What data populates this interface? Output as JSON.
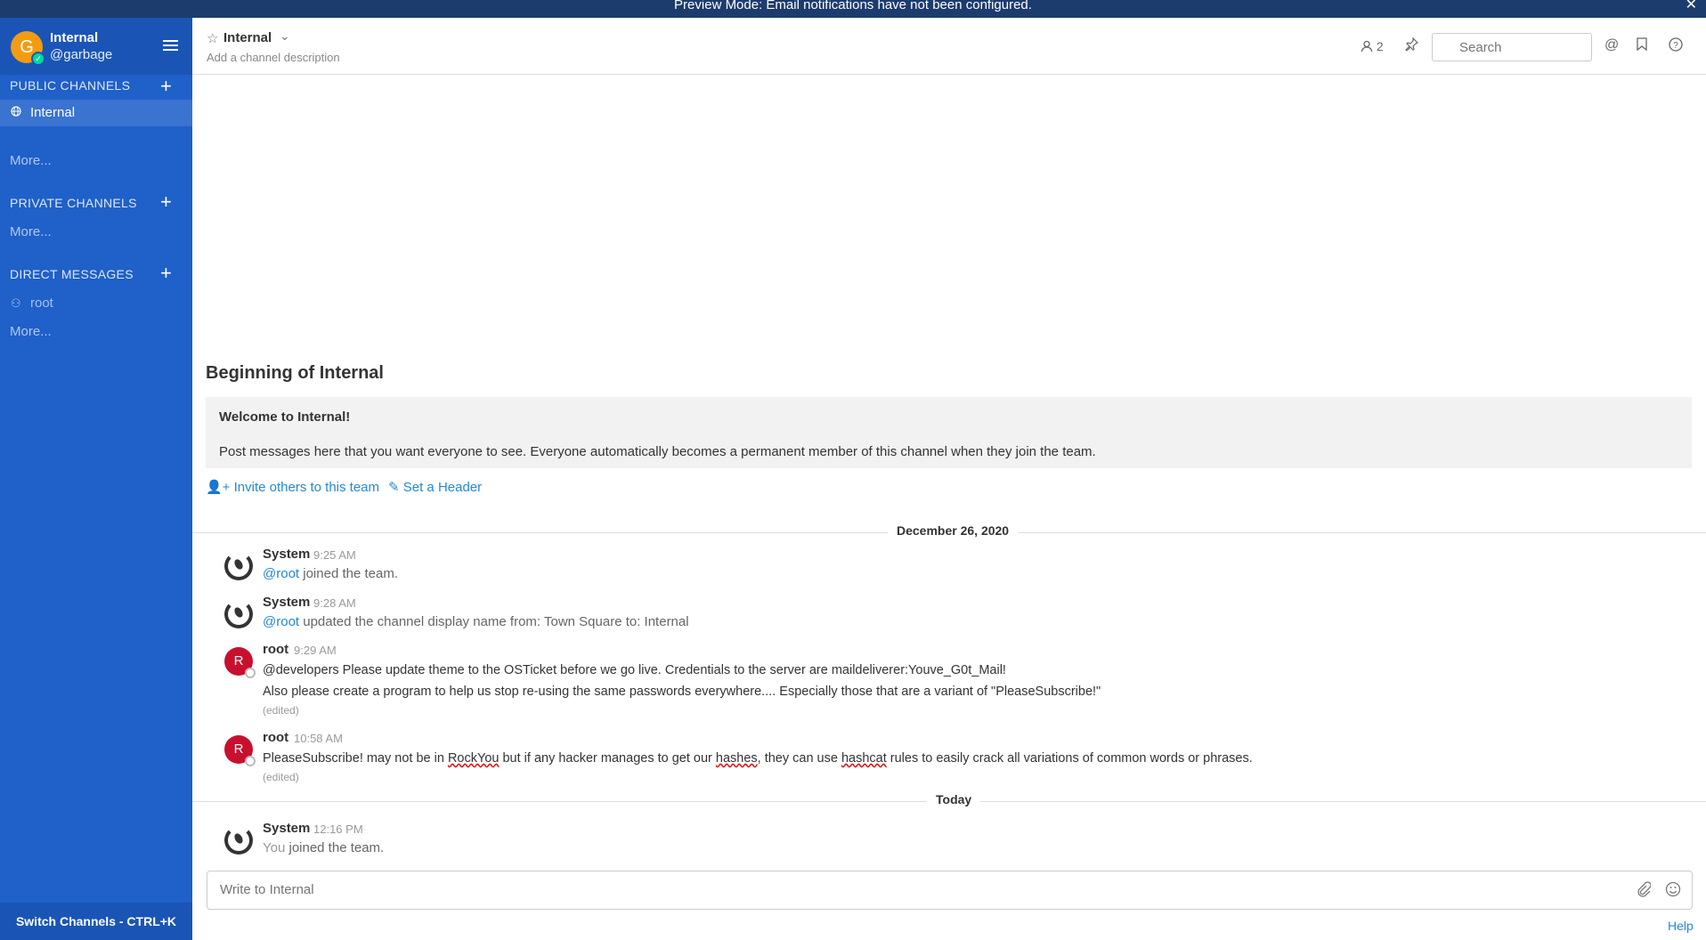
{
  "banner": {
    "text": "Preview Mode: Email notifications have not been configured.",
    "close": "✕"
  },
  "team": {
    "avatar_letter": "G",
    "name": "Internal",
    "username": "@garbage"
  },
  "sidebar": {
    "public_title": "PUBLIC CHANNELS",
    "public_channels": [
      {
        "label": "Internal",
        "icon": "globe-icon"
      }
    ],
    "public_more": "More...",
    "private_title": "PRIVATE CHANNELS",
    "private_more": "More...",
    "dm_title": "DIRECT MESSAGES",
    "dms": [
      {
        "label": "root",
        "icon": "user-status-icon"
      }
    ],
    "dm_more": "More...",
    "switch": "Switch Channels - CTRL+K"
  },
  "header": {
    "channel_name": "Internal",
    "description": "Add a channel description",
    "member_count": "2",
    "search_placeholder": "Search"
  },
  "intro": {
    "title": "Beginning of Internal",
    "welcome": "Welcome to Internal!",
    "description": "Post messages here that you want everyone to see. Everyone automatically becomes a permanent member of this channel when they join the team.",
    "invite": "Invite others to this team",
    "set_header": "Set a Header"
  },
  "dates": {
    "first": "December 26, 2020",
    "second": "Today"
  },
  "posts": [
    {
      "author": "System",
      "time": "9:25 AM",
      "mention": "@root",
      "text": " joined the team."
    },
    {
      "author": "System",
      "time": "9:28 AM",
      "mention": "@root",
      "text": " updated the channel display name from: Town Square to: Internal"
    },
    {
      "author": "root",
      "avatar": "R",
      "time": "9:29 AM",
      "line1": "@developers Please update theme to the OSTicket before we go live.  Credentials to the server are maildeliverer:Youve_G0t_Mail!",
      "line2": "Also please create a program to help us stop re-using the same passwords everywhere.... Especially those that are a variant of \"PleaseSubscribe!\"",
      "edited": "(edited)"
    },
    {
      "author": "root",
      "avatar": "R",
      "time": "10:58 AM",
      "p1": "PleaseSubscribe! may not be in ",
      "w1": "RockYou",
      "p2": " but if any hacker manages to get our ",
      "w2": "hashes",
      "p3": ", they can use ",
      "w3": "hashcat",
      "p4": " rules to easily crack all variations of common words or phrases.",
      "edited": "(edited)"
    },
    {
      "author": "System",
      "time": "12:16 PM",
      "you": "You",
      "text": " joined the team."
    }
  ],
  "composer": {
    "placeholder": "Write to Internal",
    "help": "Help"
  }
}
